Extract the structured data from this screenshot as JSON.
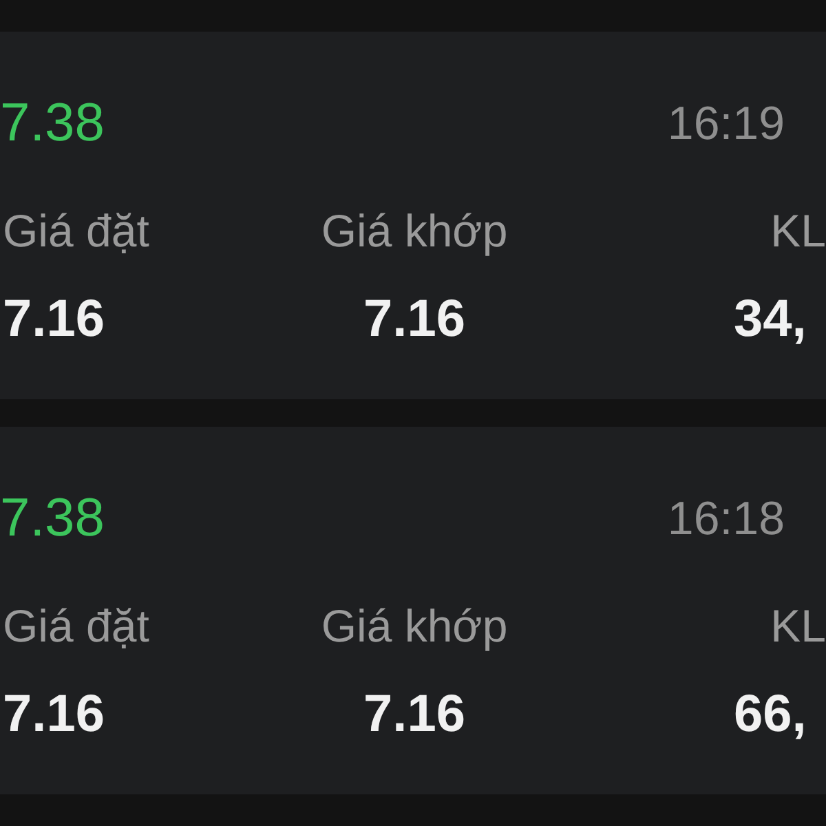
{
  "orders": [
    {
      "price": "7.38",
      "time": "16:19",
      "fields": [
        {
          "kind": "start",
          "label": "Giá đặt",
          "value": "7.16"
        },
        {
          "kind": "center",
          "label": "Giá khớp",
          "value": "7.16"
        },
        {
          "kind": "end",
          "label": "KL",
          "value": "34,"
        }
      ]
    },
    {
      "price": "7.38",
      "time": "16:18",
      "fields": [
        {
          "kind": "start",
          "label": "Giá đặt",
          "value": "7.16"
        },
        {
          "kind": "center",
          "label": "Giá khớp",
          "value": "7.16"
        },
        {
          "kind": "end",
          "label": "KL",
          "value": "66,"
        }
      ]
    }
  ]
}
